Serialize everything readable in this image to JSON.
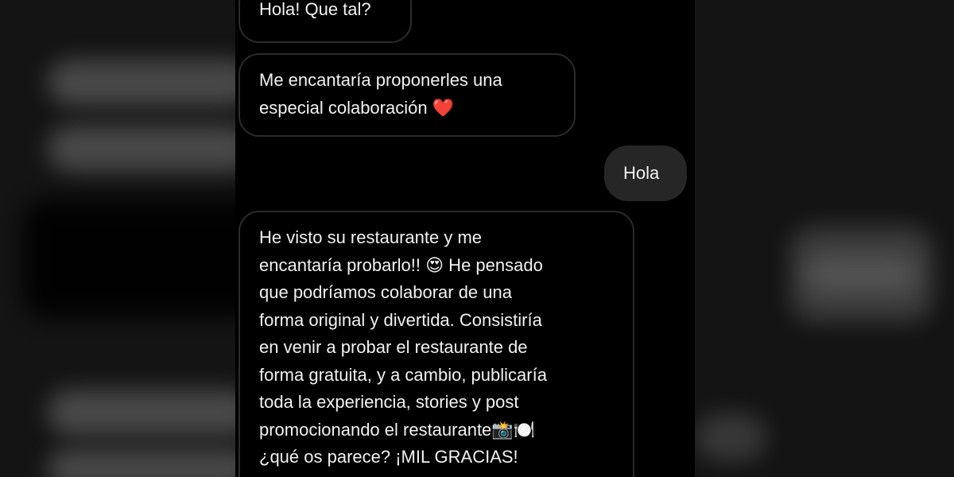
{
  "conversation": {
    "messages": [
      {
        "direction": "incoming",
        "text": "Hola! Que tal?"
      },
      {
        "direction": "incoming",
        "text": "Me encantaría proponerles una\nespecial colaboración ❤️"
      },
      {
        "direction": "outgoing",
        "text": "Hola"
      },
      {
        "direction": "incoming",
        "text": "He visto su restaurante y me\nencantaría probarlo!! 😍  He pensado\nque podríamos colaborar de una\nforma original y divertida. Consistiría\nen venir a probar el restaurante de\nforma gratuita, y a cambio, publicaría\ntoda la experiencia, stories y post\npromocionando el restaurante📸🍽️\n¿qué os parece? ¡MIL GRACIAS!"
      }
    ]
  },
  "colors": {
    "background": "#000000",
    "incoming_border": "#2b2b2b",
    "outgoing_bubble": "#262626",
    "text": "#f2f2f2"
  }
}
